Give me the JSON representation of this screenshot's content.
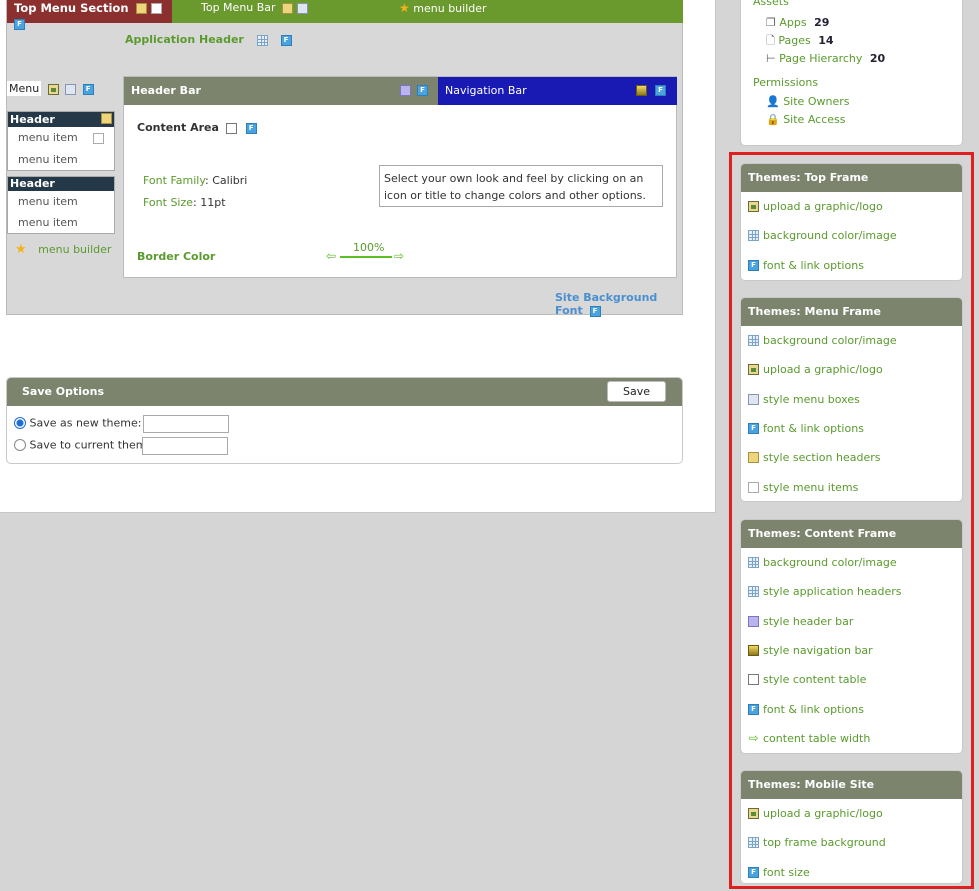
{
  "preview": {
    "top_menu_section": "Top Menu Section",
    "top_menu_bar": "Top Menu Bar",
    "menu_builder_top": "menu builder",
    "application_header": "Application Header",
    "menu_label": "Menu",
    "menu_groups": [
      {
        "header": "Header",
        "items": [
          "menu item",
          "menu item"
        ]
      },
      {
        "header": "Header",
        "items": [
          "menu item",
          "menu item"
        ]
      }
    ],
    "menu_builder_left": "menu builder",
    "header_bar": "Header Bar",
    "navigation_bar": "Navigation Bar",
    "content_area": "Content Area",
    "font_family_label": "Font Family",
    "font_family_value": "Calibri",
    "font_size_label": "Font Size",
    "font_size_value": "11pt",
    "info_text": "Select your own look and feel by clicking on an icon or title to change colors and other options.",
    "border_color": "Border Color",
    "width_percent": "100%",
    "site_background_font": "Site Background Font"
  },
  "save_options": {
    "title": "Save Options",
    "save_button": "Save",
    "option_new": "Save as new theme:",
    "option_current": "Save to current theme:",
    "new_value": "",
    "current_value": ""
  },
  "assets": {
    "heading": "Assets",
    "items": [
      {
        "label": "Apps",
        "count": "29"
      },
      {
        "label": "Pages",
        "count": "14"
      },
      {
        "label": "Page Hierarchy",
        "count": "20"
      }
    ],
    "permissions_heading": "Permissions",
    "permissions": [
      "Site Owners",
      "Site Access"
    ]
  },
  "themes": [
    {
      "title": "Themes: Top Frame",
      "items": [
        {
          "label": "upload a graphic/logo",
          "icon": "image-icon"
        },
        {
          "label": "background color/image",
          "icon": "grid-icon"
        },
        {
          "label": "font & link options",
          "icon": "font-icon"
        }
      ]
    },
    {
      "title": "Themes: Menu Frame",
      "items": [
        {
          "label": "background color/image",
          "icon": "grid-icon"
        },
        {
          "label": "upload a graphic/logo",
          "icon": "image-icon"
        },
        {
          "label": "style menu boxes",
          "icon": "boxes-icon"
        },
        {
          "label": "font & link options",
          "icon": "font-icon"
        },
        {
          "label": "style section headers",
          "icon": "yellow-box-icon"
        },
        {
          "label": "style menu items",
          "icon": "document-icon"
        }
      ]
    },
    {
      "title": "Themes: Content Frame",
      "items": [
        {
          "label": "background color/image",
          "icon": "grid-icon"
        },
        {
          "label": "style application headers",
          "icon": "grid-icon"
        },
        {
          "label": "style header bar",
          "icon": "purple-box-icon"
        },
        {
          "label": "style navigation bar",
          "icon": "nav-box-icon"
        },
        {
          "label": "style content table",
          "icon": "white-box-icon"
        },
        {
          "label": "font & link options",
          "icon": "font-icon"
        },
        {
          "label": "content table width",
          "icon": "arrow-right-icon"
        }
      ]
    },
    {
      "title": "Themes: Mobile Site",
      "items": [
        {
          "label": "upload a graphic/logo",
          "icon": "image-icon"
        },
        {
          "label": "top frame background",
          "icon": "grid-icon"
        },
        {
          "label": "font size",
          "icon": "font-icon"
        }
      ]
    }
  ],
  "colors": {
    "top_section": "#8c2f2f",
    "top_bar": "#6a9a2e",
    "header_bar": "#7c846e",
    "nav_bar": "#1919b4",
    "highlight_border": "#e02020",
    "link_green": "#5a9a2e"
  }
}
